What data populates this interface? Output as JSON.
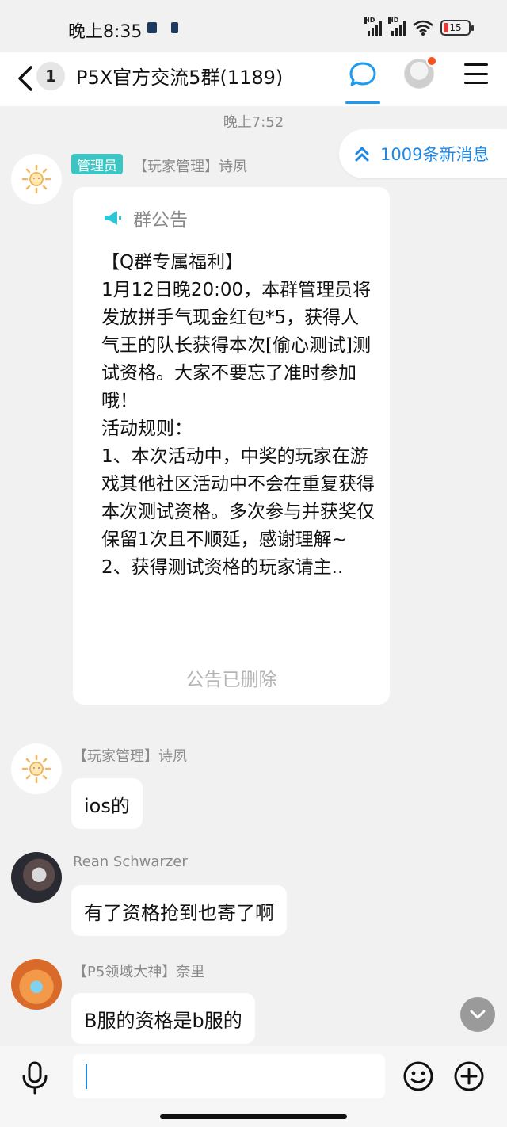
{
  "status_bar": {
    "time": "晚上8:35",
    "signal_1_label": "HD",
    "signal_2_label": "HD",
    "battery_level": "15",
    "battery_color": "#e53935"
  },
  "navbar": {
    "back_icon": "chevron-left-icon",
    "unread_count": "1",
    "title": "P5X官方交流5群(1189)",
    "active_tab_color": "#1e9bf0",
    "icons": [
      "chat-bubble-icon",
      "profile-avatar",
      "menu-icon"
    ]
  },
  "chat": {
    "timestamp": "晚上7:52",
    "new_messages": "1009条新消息",
    "messages": [
      {
        "role_badge": "管理员",
        "sender": "【玩家管理】诗夙",
        "notice": {
          "title": "群公告",
          "body": "【Q群专属福利】\n1月12日晚20:00，本群管理员将发放拼手气现金红包*5，获得人气王的队长获得本次[偷心测试]测试资格。大家不要忘了准时参加哦！\n活动规则：\n1、本次活动中，中奖的玩家在游戏其他社区活动中不会在重复获得本次测试资格。多次参与并获奖仅保留1次且不顺延，感谢理解~\n2、获得测试资格的玩家请主..",
          "footer": "公告已删除"
        }
      },
      {
        "sender": "【玩家管理】诗夙",
        "text": "ios的"
      },
      {
        "sender": "Rean Schwarzer",
        "text": "有了资格抢到也寄了啊"
      },
      {
        "sender": "【P5领域大神】奈里",
        "text": "B服的资格是b服的"
      }
    ]
  },
  "input_bar": {
    "value": "",
    "icons": [
      "microphone-icon",
      "emoji-icon",
      "plus-icon"
    ]
  },
  "colors": {
    "accent_blue": "#1e88e5",
    "admin_badge": "#3cc5c2",
    "background": "#f1f1f1"
  }
}
